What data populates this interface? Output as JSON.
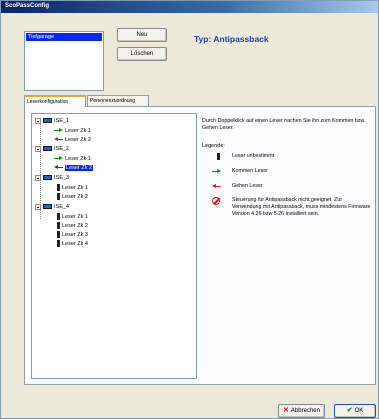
{
  "window": {
    "title": "ScoPassConfig"
  },
  "profiles": {
    "items": [
      "Tiefgarage"
    ]
  },
  "buttons": {
    "new": "Neu",
    "delete": "Löschen",
    "cancel": "Abbrechen",
    "ok": "OK"
  },
  "type_label": "Typ: Antipassback",
  "tabs": [
    "Leserkonfiguration",
    "Personenzuordnung"
  ],
  "tree": {
    "groups": [
      {
        "label": "ISE_1",
        "readers": [
          {
            "label": "Leser Zk 1",
            "icon": "arrow-right-green-icon"
          },
          {
            "label": "Leser Zk 2",
            "icon": "arrow-left-red-icon"
          }
        ]
      },
      {
        "label": "ISE_2",
        "readers": [
          {
            "label": "Leser Zk 1",
            "icon": "arrow-right-green-icon"
          },
          {
            "label": "Leser Zk 2",
            "icon": "arrow-left-green-icon",
            "selected": true
          }
        ]
      },
      {
        "label": "ISE_3",
        "readers": [
          {
            "label": "Leser Zk 1",
            "icon": "reader-undefined-icon"
          },
          {
            "label": "Leser Zk 2",
            "icon": "reader-undefined-icon"
          }
        ]
      },
      {
        "label": "ISE_4",
        "readers": [
          {
            "label": "Leser Zk 1",
            "icon": "reader-undefined-icon"
          },
          {
            "label": "Leser Zk 2",
            "icon": "reader-undefined-icon"
          },
          {
            "label": "Leser Zk 3",
            "icon": "reader-undefined-icon"
          },
          {
            "label": "Leser Zk 4",
            "icon": "reader-undefined-icon"
          }
        ]
      }
    ]
  },
  "description": "Durch Doppelklick auf einen Leser nachen Sie ihn zum Kommen bzw. Gehen Leser.",
  "legend": {
    "title": "Legende:",
    "items": [
      {
        "icon": "reader-undefined-icon",
        "text": "Leser unbestimmt"
      },
      {
        "icon": "arrow-green-icon",
        "text": "Kommen Leser"
      },
      {
        "icon": "arrow-red-icon",
        "text": "Gehen Leser"
      },
      {
        "icon": "no-entry-icon",
        "text": "Steuerung für Antipassback nicht geeignet. Zur Verwendung mit Antipassback, muss mindestens Firmware Version 4.26 bzw 5.26 installiert sein."
      }
    ]
  },
  "colors": {
    "selection": "#0b24fb",
    "type_label": "#1b3fa8",
    "kommen": "#178a17",
    "gehen": "#c02020"
  }
}
